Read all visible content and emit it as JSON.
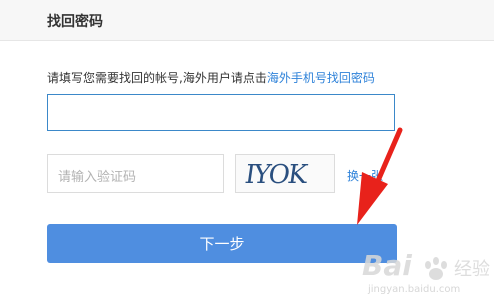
{
  "page": {
    "title": "找回密码",
    "instruction_text": "请填写您需要找回的帐号,海外用户请点击",
    "overseas_link": "海外手机号找回密码"
  },
  "form": {
    "account_value": "",
    "captcha_placeholder": "请输入验证码",
    "captcha_image_text": "IYOK",
    "refresh_link": "换一张",
    "next_button": "下一步"
  },
  "watermark": {
    "brand": "Bai",
    "site": "jingyan.baidu.com"
  },
  "colors": {
    "accent": "#4f8ee0",
    "link": "#2e82d9",
    "annotation_arrow": "#e8221b"
  },
  "icons": [
    "annotation-arrow",
    "captcha-image",
    "baidu-watermark-logo"
  ]
}
